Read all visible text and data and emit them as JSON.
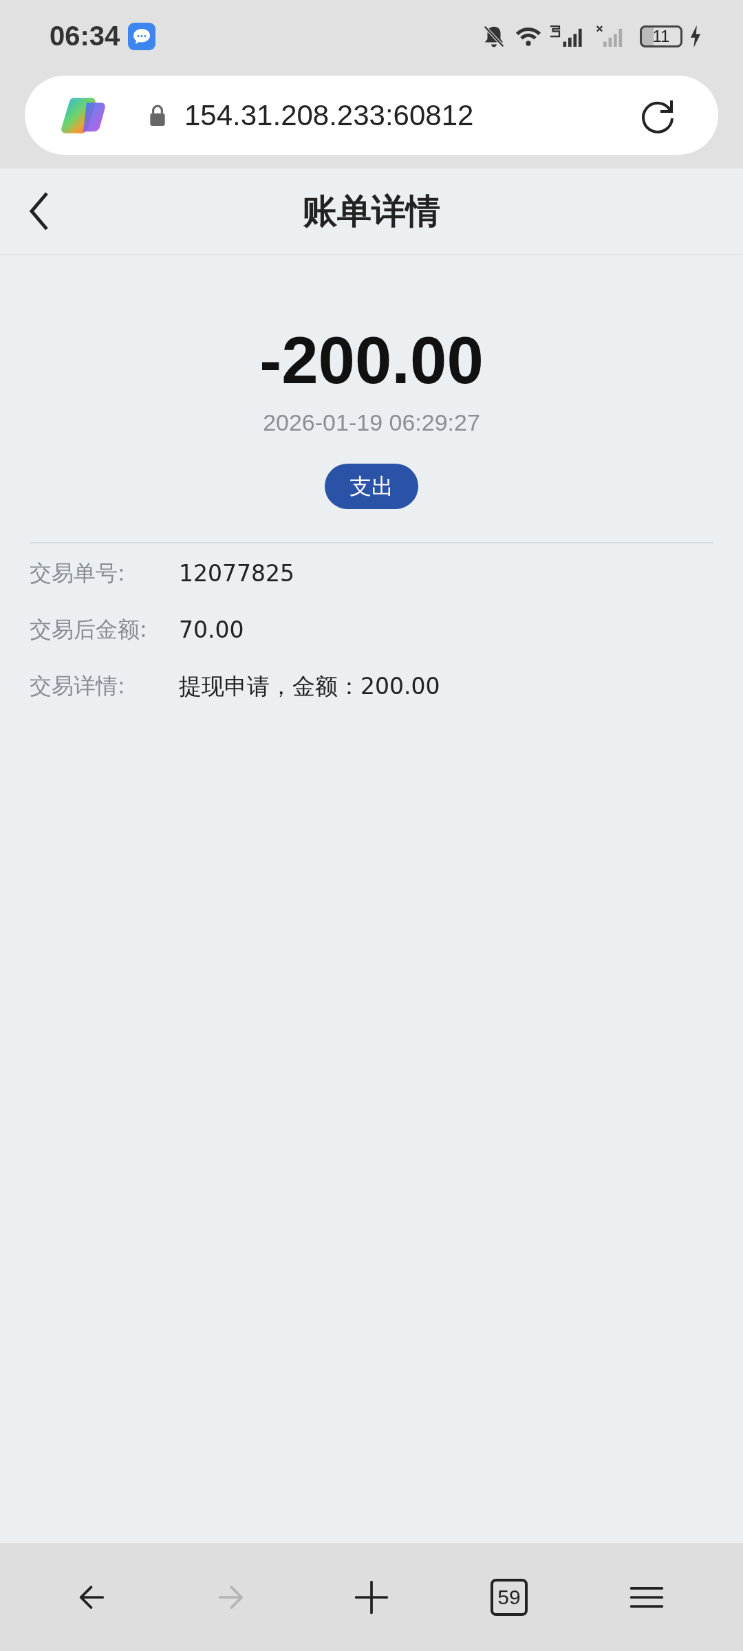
{
  "status_bar": {
    "time": "06:34",
    "battery": "11"
  },
  "address_bar": {
    "url": "154.31.208.233:60812"
  },
  "header": {
    "title": "账单详情"
  },
  "bill": {
    "amount": "-200.00",
    "time": "2026-01-19 06:29:27",
    "tag": "支出"
  },
  "details": [
    {
      "label": "交易单号:",
      "value": "12077825"
    },
    {
      "label": "交易后金额:",
      "value": "70.00"
    },
    {
      "label": "交易详情:",
      "value": "提现申请，金额：200.00"
    }
  ],
  "browser_nav": [
    {
      "kind": "back",
      "disabled": false
    },
    {
      "kind": "forward",
      "disabled": true
    },
    {
      "kind": "new-tab",
      "disabled": false
    },
    {
      "kind": "tabs",
      "disabled": false,
      "count": "59"
    },
    {
      "kind": "menu",
      "disabled": false
    }
  ]
}
